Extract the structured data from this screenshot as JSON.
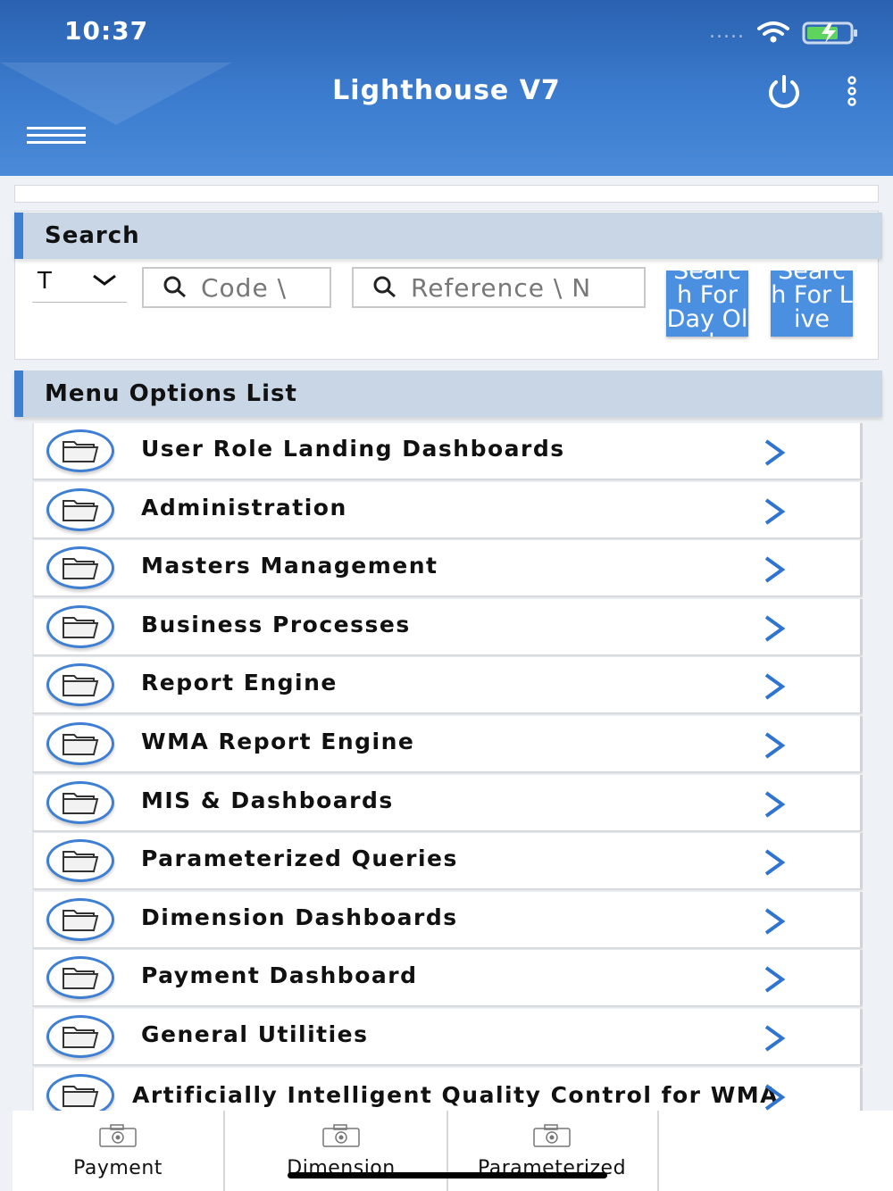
{
  "status_bar": {
    "time": "10:37",
    "signal_dots": "....."
  },
  "header": {
    "title": "Lighthouse V7"
  },
  "search": {
    "section_title": "Search",
    "type_value": "T",
    "code_placeholder": "Code \\",
    "reference_placeholder": "Reference \\ N",
    "btn_day_label": "Search For Day Old",
    "btn_live_label": "Search For Live"
  },
  "menu": {
    "section_title": "Menu Options List",
    "items": [
      {
        "label": "User Role Landing Dashboards"
      },
      {
        "label": "Administration"
      },
      {
        "label": "Masters Management"
      },
      {
        "label": "Business Processes"
      },
      {
        "label": "Report Engine"
      },
      {
        "label": "WMA Report Engine"
      },
      {
        "label": "MIS & Dashboards"
      },
      {
        "label": "Parameterized Queries"
      },
      {
        "label": "Dimension Dashboards"
      },
      {
        "label": "Payment Dashboard"
      },
      {
        "label": "General Utilities"
      },
      {
        "label": "Artificially Intelligent Quality Control for WMA"
      }
    ]
  },
  "bottom_tabs": [
    {
      "label": "Payment"
    },
    {
      "label": "Dimension"
    },
    {
      "label": "Parameterized"
    }
  ],
  "colors": {
    "header": "#3c7ccf",
    "accent": "#3d7fd0",
    "button": "#4a8fe0",
    "section_bg": "#c9d6e6"
  }
}
